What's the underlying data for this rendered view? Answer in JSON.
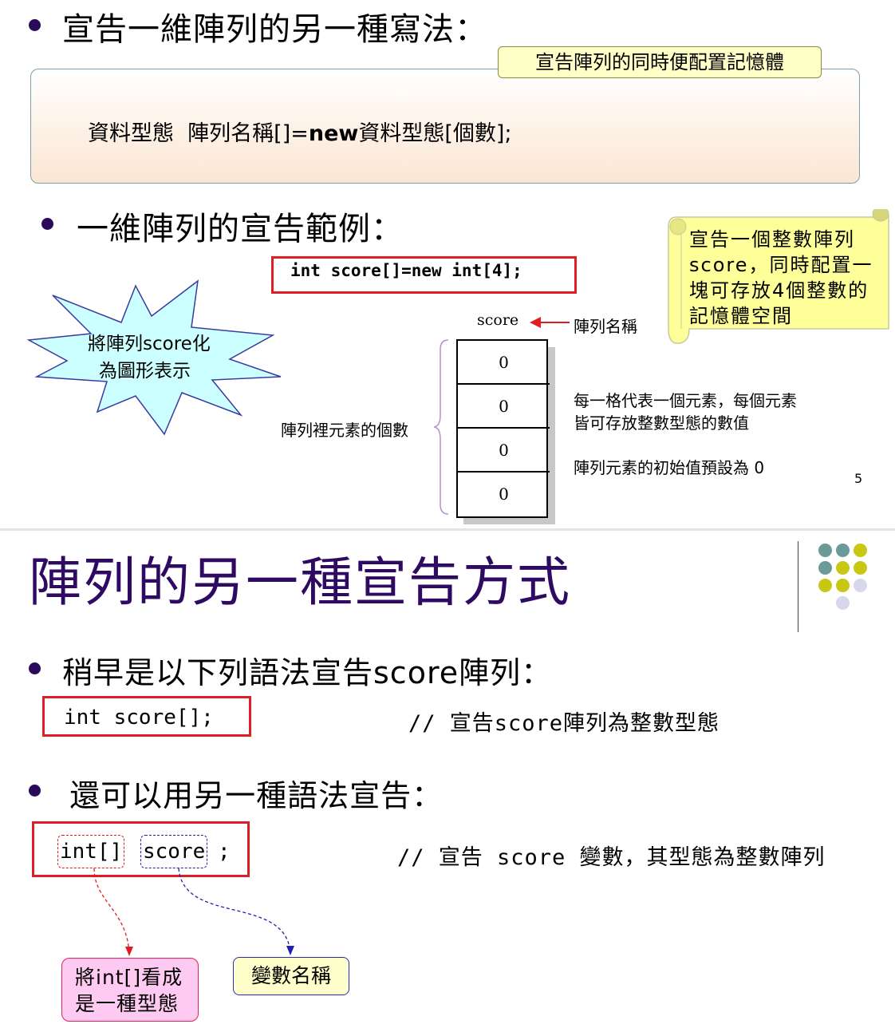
{
  "slide5": {
    "bullet1": "宣告一維陣列的另一種寫法：",
    "syntax_label": "宣告陣列的同時便配置記憶體",
    "syntax_part1": "資料型態  陣列名稱[]=",
    "syntax_new": "new",
    "syntax_part2": "資料型態[個數];",
    "bullet2": "一維陣列的宣告範例：",
    "code": "int score[]=new int[4];",
    "note": "宣告一個整數陣列score，同時配置一塊可存放4個整數的記憶體空間",
    "star_text_line1": "將陣列score化",
    "star_text_line2": "為圖形表示",
    "array_name_label": "score",
    "array_name_caption": "陣列名稱",
    "cells": [
      "0",
      "0",
      "0",
      "0"
    ],
    "count_label": "陣列裡元素的個數",
    "desc_line1": "每一格代表一個元素，每個元素",
    "desc_line2": "皆可存放整數型態的數值",
    "init_label": "陣列元素的初始值預設為 0",
    "page_number": "5"
  },
  "slide6": {
    "title": "陣列的另一種宣告方式",
    "bullet1": "稍早是以下列語法宣告score陣列：",
    "code1": "int score[];",
    "comment1": "//  宣告score陣列為整數型態",
    "bullet2": " 還可以用另一種語法宣告：",
    "code2_type": "int[]",
    "code2_name": "score",
    "code2_semicolon": ";",
    "comment2": "//  宣告 score 變數，其型態為整數陣列",
    "callout_type_line1": "將int[]看成",
    "callout_type_line2": "是一種型態",
    "callout_name": "變數名稱"
  },
  "colors": {
    "bullet": "#2a0a5a",
    "title": "#2e0a62",
    "code_border": "#e01c24",
    "note_fill": "#ffff99",
    "dot_teal": "#6a9a9a",
    "dot_olive": "#c8c814",
    "dot_lavender": "#d8d8ec"
  },
  "icons": {
    "star_callout": "explosion-shape",
    "scroll_note": "scroll-shape",
    "arrow": "left-arrow-icon",
    "brace": "left-curly-brace",
    "decoration": "dot-grid"
  }
}
